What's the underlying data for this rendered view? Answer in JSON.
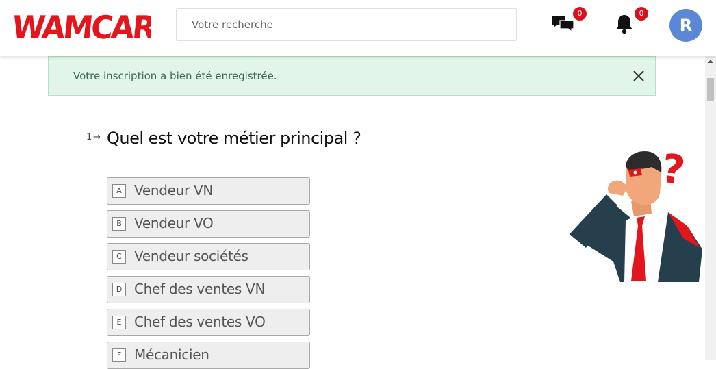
{
  "header": {
    "logo_text": "WAMCAR",
    "search_placeholder": "Votre recherche",
    "messages_badge": "0",
    "notifications_badge": "0",
    "avatar_initial": "R"
  },
  "alert": {
    "message": "Votre inscription a bien été enregistrée."
  },
  "question": {
    "number": "1",
    "arrow": "→",
    "text": "Quel est votre métier principal ?",
    "options": [
      {
        "key": "A",
        "label": "Vendeur VN"
      },
      {
        "key": "B",
        "label": "Vendeur VO"
      },
      {
        "key": "C",
        "label": "Vendeur sociétés"
      },
      {
        "key": "D",
        "label": "Chef des ventes VN"
      },
      {
        "key": "E",
        "label": "Chef des ventes VO"
      },
      {
        "key": "F",
        "label": "Mécanicien"
      }
    ]
  },
  "colors": {
    "brand_red": "#e3151d",
    "alert_bg": "#e1f6e8",
    "avatar_bg": "#5b87d6",
    "badge_red": "#d9131d"
  },
  "icons": {
    "messages": "chat-bubbles-icon",
    "notifications": "bell-icon",
    "close": "close-icon"
  }
}
